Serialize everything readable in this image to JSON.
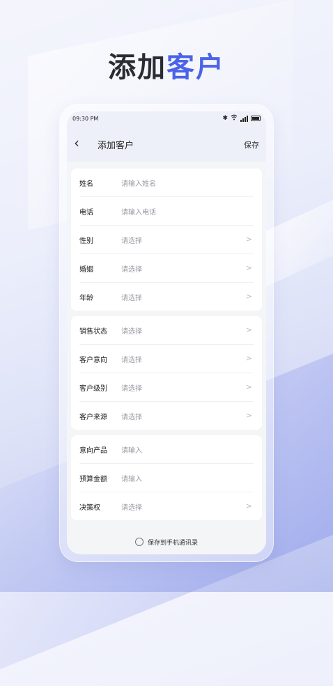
{
  "headline": {
    "part1": "添加",
    "part2": "客户"
  },
  "status_bar": {
    "time": "09:30 PM",
    "bluetooth": "bluetooth-icon",
    "wifi": "wifi-icon",
    "signal": "signal-icon",
    "battery": "battery-icon"
  },
  "nav": {
    "back": "‹",
    "title": "添加客户",
    "save": "保存"
  },
  "groups": [
    {
      "rows": [
        {
          "label": "姓名",
          "value": "请输入姓名",
          "chevron": false
        },
        {
          "label": "电话",
          "value": "请输入电话",
          "chevron": false
        },
        {
          "label": "性别",
          "value": "请选择",
          "chevron": true
        },
        {
          "label": "婚姻",
          "value": "请选择",
          "chevron": true
        },
        {
          "label": "年龄",
          "value": "请选择",
          "chevron": true
        }
      ]
    },
    {
      "rows": [
        {
          "label": "销售状态",
          "value": "请选择",
          "chevron": true
        },
        {
          "label": "客户意向",
          "value": "请选择",
          "chevron": true
        },
        {
          "label": "客户级别",
          "value": "请选择",
          "chevron": true
        },
        {
          "label": "客户来源",
          "value": "请选择",
          "chevron": true
        }
      ]
    },
    {
      "rows": [
        {
          "label": "意向产品",
          "value": "请输入",
          "chevron": false
        },
        {
          "label": "预算金额",
          "value": "请输入",
          "chevron": false
        },
        {
          "label": "决策权",
          "value": "请选择",
          "chevron": true
        }
      ]
    }
  ],
  "footer": {
    "save_to_contacts": "保存到手机通讯录"
  },
  "colors": {
    "accent": "#4b63e6",
    "headline_dark": "#2a2c33"
  }
}
